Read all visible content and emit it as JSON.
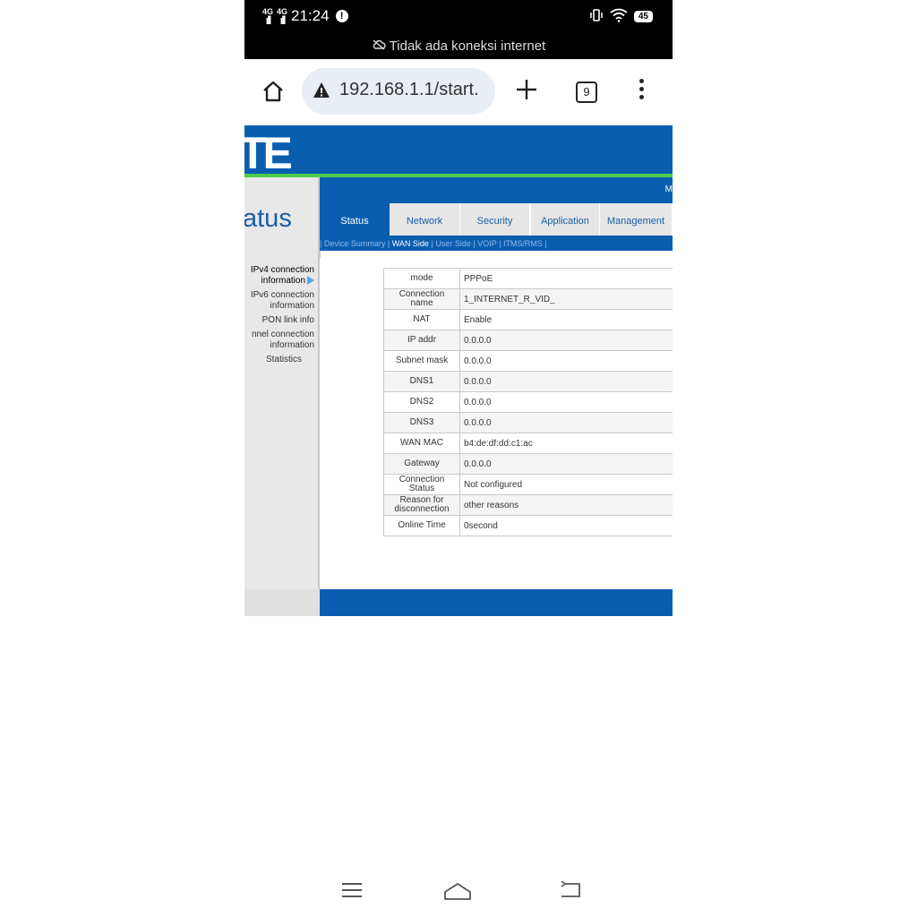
{
  "status_bar": {
    "signal1": "4G",
    "signal2": "4G",
    "time": "21:24",
    "alert": "!",
    "battery": "45",
    "notice": "Tidak ada koneksi internet"
  },
  "browser": {
    "url": "192.168.1.1/start.",
    "tab_count": "9"
  },
  "router": {
    "logo": "TE",
    "section_title": "atus",
    "nav_corner": "M",
    "tabs": [
      "Status",
      "Network",
      "Security",
      "Application",
      "Management"
    ],
    "subtabs": {
      "sep_open": "|",
      "device_summary": "Device Summary",
      "wan_side": "WAN Side",
      "user_side": "User Side",
      "voip": "VOIP",
      "itms": "ITMS/RMS",
      "sep": "|"
    },
    "left_menu": {
      "ipv4_line1": "IPv4 connection",
      "ipv4_line2": "information",
      "ipv6_line1": "IPv6 connection",
      "ipv6_line2": "information",
      "pon": "PON link info",
      "tunnel_line1": "nnel connection",
      "tunnel_line2": "information",
      "statistics": "Statistics"
    },
    "table": [
      {
        "key": "mode",
        "value": "PPPoE"
      },
      {
        "key": "Connection name",
        "value": "1_INTERNET_R_VID_"
      },
      {
        "key": "NAT",
        "value": "Enable"
      },
      {
        "key": "IP addr",
        "value": "0.0.0.0"
      },
      {
        "key": "Subnet mask",
        "value": "0.0.0.0"
      },
      {
        "key": "DNS1",
        "value": "0.0.0.0"
      },
      {
        "key": "DNS2",
        "value": "0.0.0.0"
      },
      {
        "key": "DNS3",
        "value": "0.0.0.0"
      },
      {
        "key": "WAN MAC",
        "value": "b4:de:df:dd:c1:ac"
      },
      {
        "key": "Gateway",
        "value": "0.0.0.0"
      },
      {
        "key": "Connection Status",
        "value": "Not configured"
      },
      {
        "key": "Reason for disconnection",
        "value": "other reasons"
      },
      {
        "key": "Online Time",
        "value": "0second"
      }
    ]
  },
  "colors": {
    "brand_blue": "#0a5eb0",
    "accent_green": "#4dcc4a"
  }
}
